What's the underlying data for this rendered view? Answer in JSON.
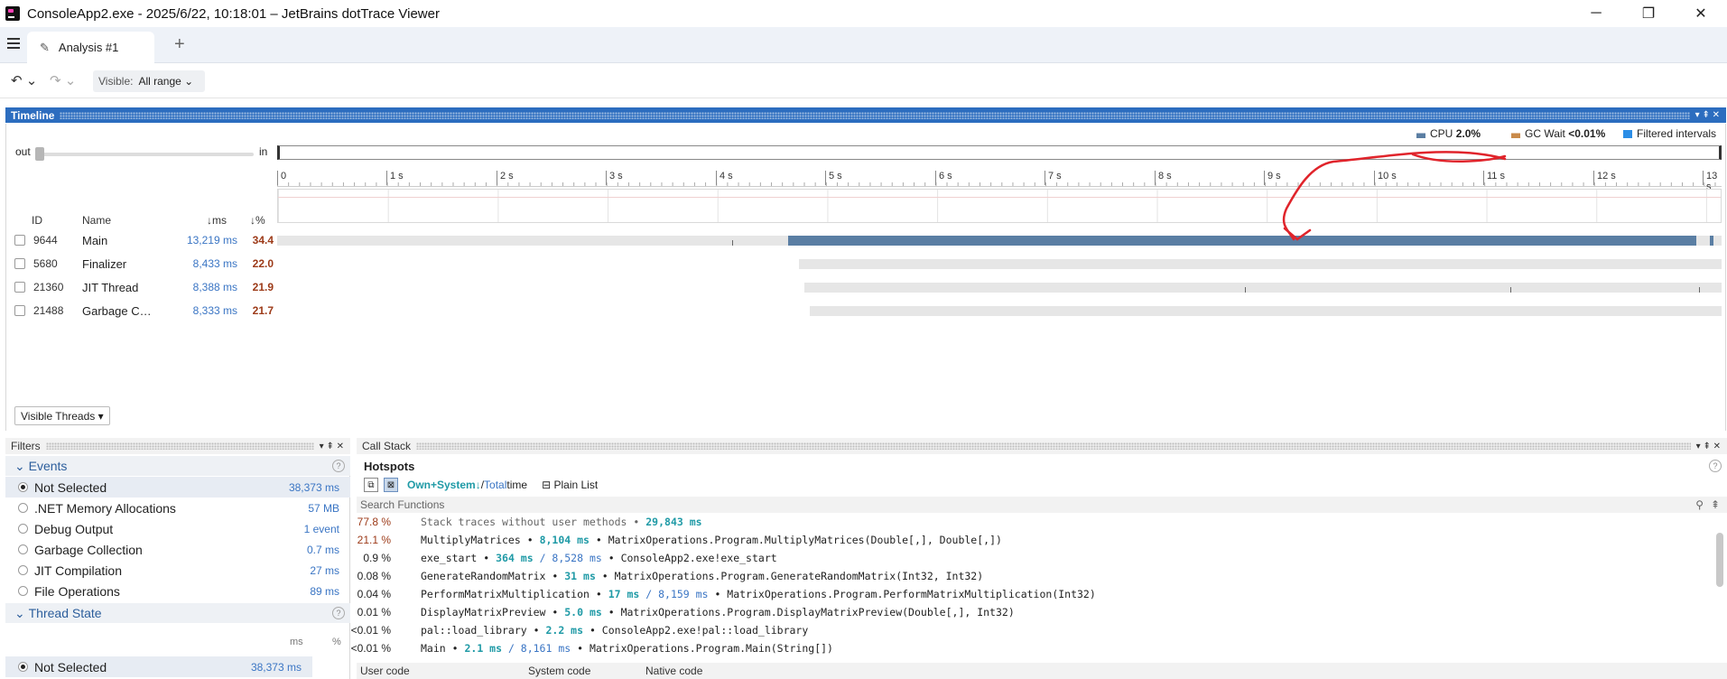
{
  "window": {
    "title": "ConsoleApp2.exe - 2025/6/22, 10:18:01 – JetBrains dotTrace Viewer",
    "minimize": "─",
    "maximize": "❐",
    "close": "✕"
  },
  "tabbar": {
    "tab_label": "Analysis #1",
    "add": "+"
  },
  "toolbar": {
    "undo": "↶ ⌄",
    "redo": "↷ ⌄",
    "visible_label": "Visible:",
    "visible_value": "All range ⌄"
  },
  "timeline": {
    "title": "Timeline",
    "controls": "▾ ⇞ ✕",
    "legend": {
      "cpu_label": "CPU",
      "cpu_value": "2.0%",
      "gc_label": "GC Wait",
      "gc_value": "<0.01%",
      "filtered_label": "Filtered intervals"
    },
    "zoom_out": "out",
    "zoom_in": "in",
    "ticks": [
      "0",
      "1 s",
      "2 s",
      "3 s",
      "4 s",
      "5 s",
      "6 s",
      "7 s",
      "8 s",
      "9 s",
      "10 s",
      "11 s",
      "12 s",
      "13 s"
    ],
    "columns": {
      "id": "ID",
      "name": "Name",
      "ms": "↓ms",
      "pct": "↓%"
    },
    "threads": [
      {
        "id": "9644",
        "name": "Main",
        "ms": "13,219 ms",
        "pct": "34.4"
      },
      {
        "id": "5680",
        "name": "Finalizer",
        "ms": "8,433 ms",
        "pct": "22.0"
      },
      {
        "id": "21360",
        "name": "JIT Thread",
        "ms": "8,388 ms",
        "pct": "21.9"
      },
      {
        "id": "21488",
        "name": "Garbage Coll...",
        "ms": "8,333 ms",
        "pct": "21.7"
      }
    ],
    "visible_threads_button": "Visible Threads ▾"
  },
  "filters": {
    "title": "Filters",
    "controls": "▾ ⇞ ✕",
    "events_title": "Events",
    "events": [
      {
        "label": "Not Selected",
        "value": "38,373 ms",
        "selected": true
      },
      {
        "label": ".NET Memory Allocations",
        "value": "57 MB"
      },
      {
        "label": "Debug Output",
        "value": "1 event"
      },
      {
        "label": "Garbage Collection",
        "value": "0.7 ms"
      },
      {
        "label": "JIT Compilation",
        "value": "27 ms"
      },
      {
        "label": "File Operations",
        "value": "89 ms"
      }
    ],
    "thread_state_title": "Thread State",
    "thread_state_cols": {
      "ms": "ms",
      "pct": "%"
    },
    "thread_state_row": {
      "label": "Not Selected",
      "value": "38,373 ms"
    }
  },
  "callstack": {
    "title": "Call Stack",
    "controls": "▾ ⇞ ✕",
    "tab": "Hotspots",
    "mode_own": "Own+System↓",
    "mode_sep": " / ",
    "mode_total": "Total",
    "mode_time": " time",
    "plain_list": "Plain List",
    "search_placeholder": "Search Functions",
    "rows": [
      {
        "pct": "77.8 %",
        "pre": "Stack traces without user methods • ",
        "ms": "29,843 ms",
        "tot": "",
        "post": ""
      },
      {
        "pct": "21.1 %",
        "pre": "MultiplyMatrices • ",
        "ms": "8,104 ms",
        "tot": "",
        "post": " • MatrixOperations.Program.MultiplyMatrices(Double[,], Double[,])"
      },
      {
        "pct": "0.9 %",
        "pre": "exe_start • ",
        "ms": "364 ms",
        "tot": " / 8,528 ms",
        "post": " • ConsoleApp2.exe!exe_start"
      },
      {
        "pct": "0.08 %",
        "pre": "GenerateRandomMatrix • ",
        "ms": "31 ms",
        "tot": "",
        "post": " • MatrixOperations.Program.GenerateRandomMatrix(Int32, Int32)"
      },
      {
        "pct": "0.04 %",
        "pre": "PerformMatrixMultiplication • ",
        "ms": "17 ms",
        "tot": " / 8,159 ms",
        "post": " • MatrixOperations.Program.PerformMatrixMultiplication(Int32)"
      },
      {
        "pct": "0.01 %",
        "pre": "DisplayMatrixPreview • ",
        "ms": "5.0 ms",
        "tot": "",
        "post": " • MatrixOperations.Program.DisplayMatrixPreview(Double[,], Int32)"
      },
      {
        "pct": "<0.01 %",
        "pre": "pal::load_library • ",
        "ms": "2.2 ms",
        "tot": "",
        "post": " • ConsoleApp2.exe!pal::load_library"
      },
      {
        "pct": "<0.01 %",
        "pre": "Main • ",
        "ms": "2.1 ms",
        "tot": " / 8,161 ms",
        "post": " • MatrixOperations.Program.Main(String[])"
      }
    ],
    "bottom_tabs": [
      "User code",
      "System code",
      "Native code"
    ]
  },
  "colors": {
    "accent": "#2c6dbf",
    "thread_bar": "#5a7ea3",
    "annotation": "#e0242b"
  }
}
